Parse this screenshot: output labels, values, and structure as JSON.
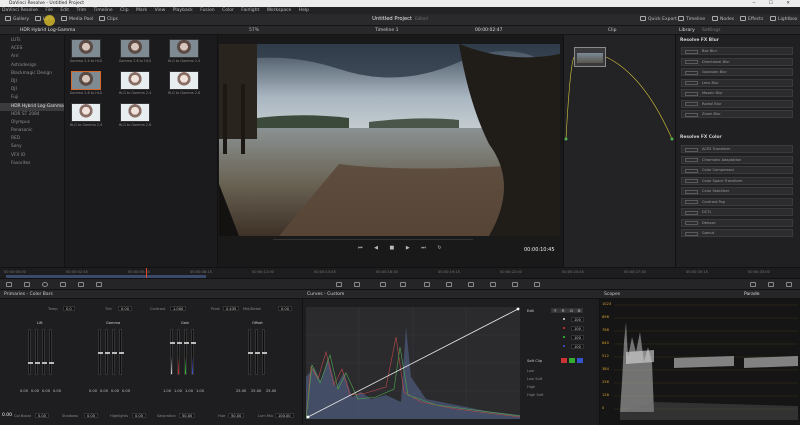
{
  "window": {
    "title": "DaVinci Resolve - Untitled Project"
  },
  "menu": [
    "DaVinci Resolve",
    "File",
    "Edit",
    "Trim",
    "Timeline",
    "Clip",
    "Mark",
    "View",
    "Playback",
    "Fusion",
    "Color",
    "Fairlight",
    "Workspace",
    "Help"
  ],
  "toolbar": {
    "gallery": "Gallery",
    "luts": "LUTs",
    "media_pool": "Media Pool",
    "clips": "Clips",
    "project_title": "Untitled Project",
    "project_status": "Edited",
    "quick_export": "Quick Export",
    "timeline": "Timeline",
    "nodes": "Nodes",
    "effects": "Effects",
    "lightbox": "Lightbox"
  },
  "lut_panel": {
    "header": "HDR Hybrid Log-Gamma",
    "items": [
      "LUTs",
      "ACES",
      "Arri",
      "Astrodesign",
      "Blackmagic Design",
      "DJI",
      "DJI",
      "Fuji",
      "HDR Hybrid Log-Gamma",
      "HDR ST 2084",
      "Olympus",
      "Panasonic",
      "RED",
      "Sony",
      "VFX IO",
      "Favorites"
    ],
    "selected_index": 8,
    "thumbs": [
      "Gamma 2.4 to HLG",
      "Gamma 2.6 to HLG",
      "HLG to Gamma 2.4",
      "Gamma 2.6 to HLG",
      "HLG to Gamma 2.4",
      "HLG to Gamma 2.6",
      "HLG to Gamma 2.4",
      "HLG to Gamma 2.6"
    ]
  },
  "viewer": {
    "zoom": "57%",
    "timeline_name": "Timeline 1",
    "source_tc": "00:00:02:47",
    "clip_label": "Clip",
    "timecode": "00:00:10:45"
  },
  "library": {
    "tab_library": "Library",
    "tab_settings": "Settings",
    "section1": "Resolve FX Blur",
    "blur_items": [
      "Box Blur",
      "Directional Blur",
      "Gaussian Blur",
      "Lens Blur",
      "Mosaic Blur",
      "Radial Blur",
      "Zoom Blur"
    ],
    "section2": "Resolve FX Color",
    "color_items": [
      "ACES Transform",
      "Chromatic Adaptation",
      "Color Compressor",
      "Color Space Transform",
      "Color Stabilizer",
      "Contrast Pop",
      "DCTL",
      "Dehaze",
      "Gamut"
    ]
  },
  "timeline_times": [
    "00:00:00:00",
    "00:00:02:45",
    "00:00:05:30",
    "00:00:08:15",
    "00:00:11:00",
    "00:00:13:45",
    "00:00:16:30",
    "00:00:19:15",
    "00:00:22:00",
    "00:00:24:45",
    "00:00:27:30",
    "00:00:30:15",
    "00:00:33:00"
  ],
  "primaries": {
    "title": "Primaries - Color Bars",
    "temp_label": "Temp",
    "temp": "0.0",
    "tint_label": "Tint",
    "tint": "0.00",
    "contrast_label": "Contrast",
    "contrast": "1.000",
    "pivot_label": "Pivot",
    "pivot": "0.435",
    "middetail_label": "Mid/Detail",
    "middetail": "0.00",
    "wheels": [
      {
        "name": "Lift",
        "values": [
          "0.00",
          "0.00",
          "0.00",
          "0.00"
        ]
      },
      {
        "name": "Gamma",
        "values": [
          "0.00",
          "0.00",
          "0.00",
          "0.00"
        ]
      },
      {
        "name": "Gain",
        "values": [
          "1.00",
          "1.00",
          "1.00",
          "1.00"
        ]
      },
      {
        "name": "Offset",
        "values": [
          "25.00",
          "25.00",
          "25.00"
        ]
      }
    ],
    "bottom": {
      "colboost_label": "Col Boost",
      "colboost": "0.00",
      "shadows_label": "Shadows",
      "shadows": "0.00",
      "highlights_label": "Highlights",
      "highlights": "0.00",
      "saturation_label": "Saturation",
      "saturation": "50.00",
      "hue_label": "Hue",
      "hue": "50.00",
      "lummix_label": "Lum Mix",
      "lummix": "100.00",
      "left_value": "0.00"
    }
  },
  "curves": {
    "title": "Curves - Custom",
    "edit_label": "Edit",
    "channels": [
      "Y",
      "R",
      "G",
      "B"
    ],
    "intensity": [
      "100",
      "100",
      "100",
      "100"
    ],
    "softclip_label": "Soft Clip",
    "softclip_rows": [
      "Low",
      "Low Soft",
      "High",
      "High Soft"
    ]
  },
  "scopes": {
    "title": "Scopes",
    "mode": "Parade",
    "ticks": [
      "1023",
      "896",
      "768",
      "640",
      "512",
      "384",
      "256",
      "128",
      "0"
    ]
  },
  "colors": {
    "accent": "#d4682f",
    "bg": "#1b1b1d"
  }
}
